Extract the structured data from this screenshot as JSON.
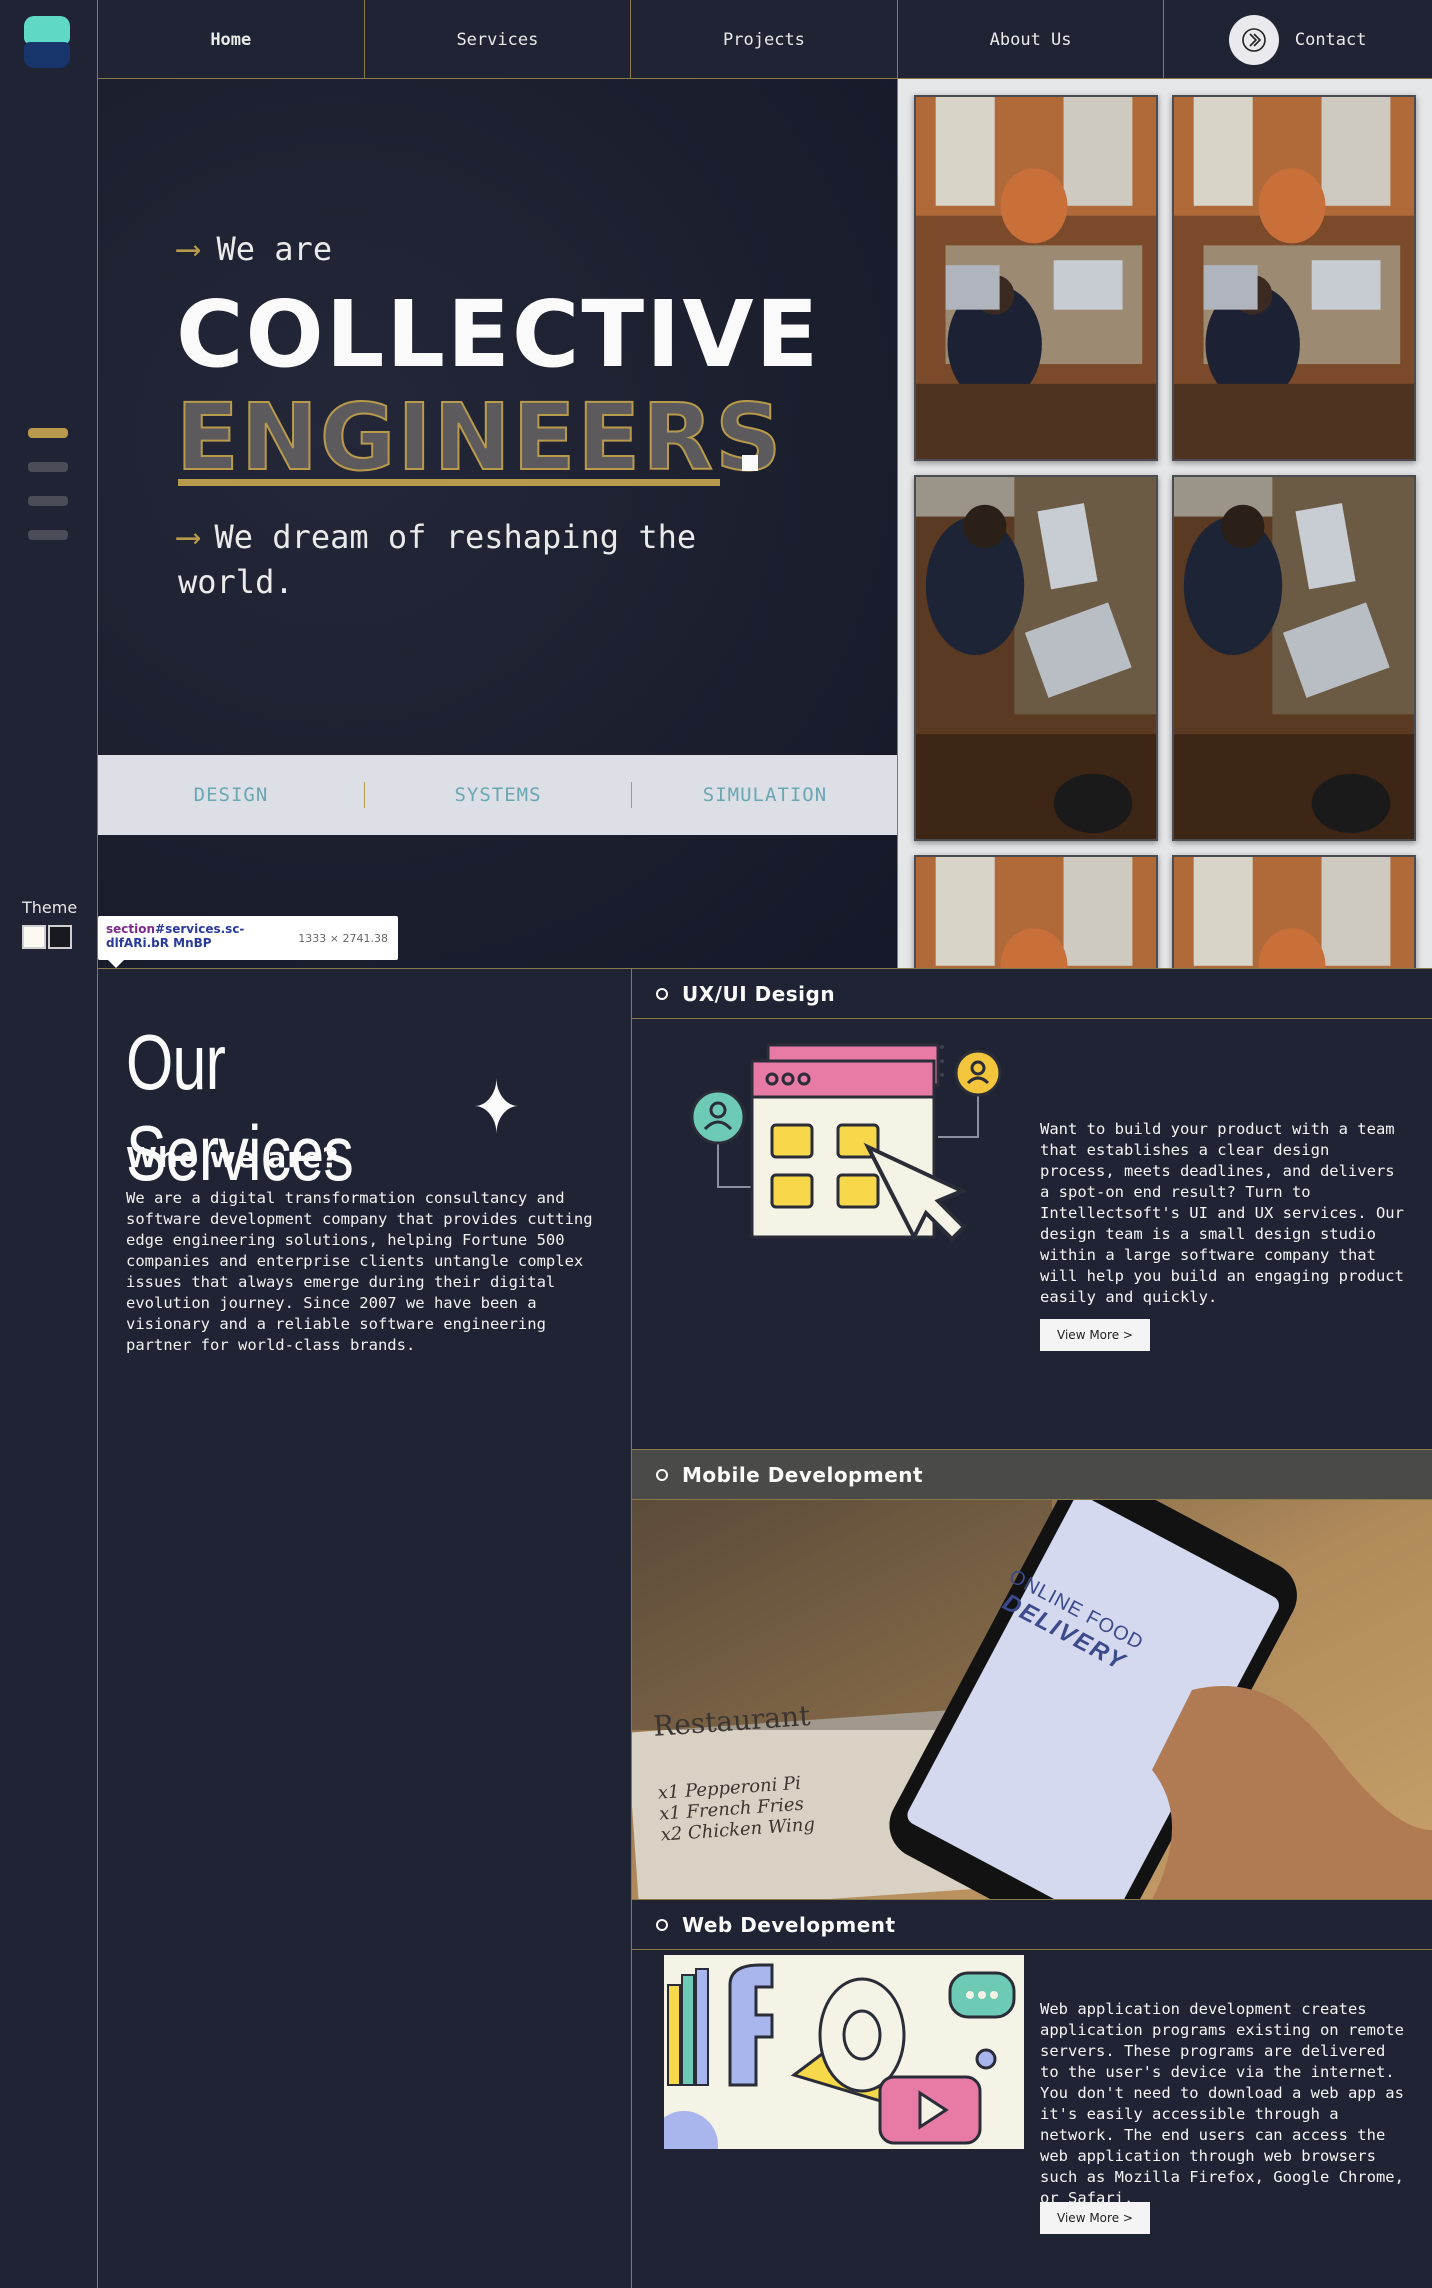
{
  "nav": {
    "items": [
      "Home",
      "Services",
      "Projects",
      "About Us"
    ],
    "contact": "Contact"
  },
  "sidebar": {
    "theme_label": "Theme"
  },
  "hero": {
    "we_are": "We are",
    "headline_1": "COLLECTIVE",
    "headline_2": "ENGINEERS",
    "tagline": "We dream of reshaping the world.",
    "pillars": [
      "DESIGN",
      "SYSTEMS",
      "SIMULATION"
    ]
  },
  "devtools_tooltip": {
    "selector_tag": "section",
    "selector_rest": "#services.sc-dlfARi.bR MnBP",
    "dimensions": "1333 × 2741.38"
  },
  "services": {
    "title": "Our Services",
    "who_heading": "Who we are?",
    "who_body": "We are a digital transformation consultancy and software development company that provides cutting edge engineering solutions, helping Fortune 500 companies and enterprise clients untangle complex issues that always emerge during their digital evolution journey. Since 2007 we have been a visionary and a reliable software engineering partner for world-class brands.",
    "items": [
      {
        "title": "UX/UI Design",
        "description": "Want to build your product with a team that establishes a clear design process, meets deadlines, and delivers a spot-on end result? Turn to Intellectsoft's UI and UX services. Our design team is a small design studio within a large software company that will help you build an engaging product easily and quickly.",
        "button": "View More >"
      },
      {
        "title": "Mobile Development",
        "image_text_1": "ONLINE FOOD",
        "image_text_2": "DELIVERY",
        "receipt_title": "Restaurant",
        "receipt_lines": [
          "x1 Pepperoni Pi",
          "x1 French Fries",
          "x2 Chicken Wing"
        ]
      },
      {
        "title": "Web Development",
        "description": "Web application development creates application programs existing on remote servers. These programs are delivered to the user's device via the internet. You don't need to download a web app as it's easily accessible through a network. The end users can access the web application through web browsers such as Mozilla Firefox, Google Chrome, or Safari.",
        "button": "View More >"
      }
    ]
  },
  "colors": {
    "background": "#1e2231",
    "accent_gold": "#b89a4c",
    "accent_teal": "#5fd9c6",
    "pillar_text": "#6aa7b3"
  }
}
